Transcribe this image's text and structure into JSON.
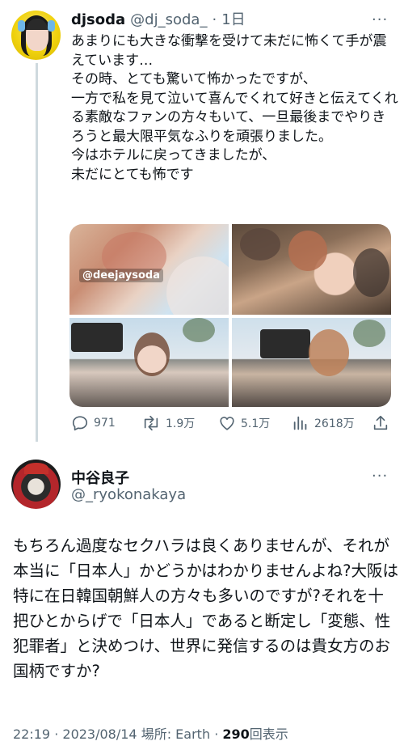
{
  "tweet1": {
    "display_name": "djsoda",
    "handle": "@dj_soda_",
    "separator": "·",
    "time": "1日",
    "more": "···",
    "text": "あまりにも大きな衝撃を受けて未だに怖くて手が震えています…\nその時、とても驚いて怖かったですが、\n一方で私を見て泣いて喜んでくれて好きと伝えてくれる素敵なファンの方々もいて、一旦最後までやりきろうと最大限平気なふりを頑張りました。\n今はホテルに戻ってきましたが、\n未だにとても怖です",
    "media_watermark": "@deejaysoda",
    "stats": {
      "replies": "971",
      "retweets": "1.9万",
      "likes": "5.1万",
      "views": "2618万"
    },
    "icons": [
      "reply-icon",
      "retweet-icon",
      "like-icon",
      "views-icon",
      "share-icon"
    ]
  },
  "tweet2": {
    "display_name": "中谷良子",
    "handle": "@_ryokonakaya",
    "more": "···",
    "text": "もちろん過度なセクハラは良くありませんが、それが本当に「日本人」かどうかはわかりませんよね?大阪は特に在日韓国朝鮮人の方々も多いのですが?それを十把ひとからげで「日本人」であると断定し「変態、性犯罪者」と決めつけ、世界に発信するのは貴女方のお国柄ですか?",
    "meta": {
      "time": "22:19",
      "dot1": "·",
      "date": "2023/08/14",
      "location_label": "場所: Earth",
      "dot2": "·",
      "views_count": "290",
      "views_label": "回表示"
    }
  },
  "colors": {
    "text": "#0f1419",
    "secondary": "#536471",
    "thread_line": "#cfd9de",
    "background": "#ffffff"
  }
}
